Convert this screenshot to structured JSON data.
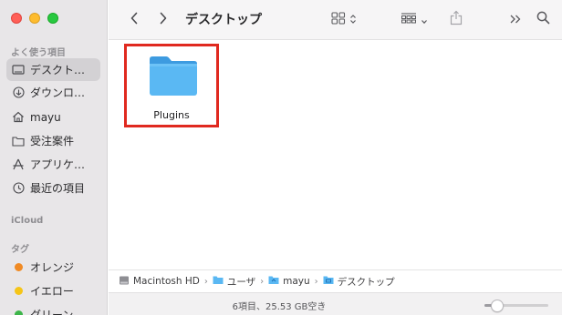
{
  "sidebar": {
    "favorites_title": "よく使う項目",
    "favorites": [
      {
        "label": "デスクトップ",
        "display": "デスクト…",
        "icon": "desktop-icon",
        "selected": true
      },
      {
        "label": "ダウンロード",
        "display": "ダウンロ…",
        "icon": "download-icon",
        "selected": false
      },
      {
        "label": "mayu",
        "display": "mayu",
        "icon": "home-icon",
        "selected": false
      },
      {
        "label": "受注案件",
        "display": "受注案件",
        "icon": "folder-icon",
        "selected": false
      },
      {
        "label": "アプリケーション",
        "display": "アプリケ…",
        "icon": "applications-icon",
        "selected": false
      },
      {
        "label": "最近の項目",
        "display": "最近の項目",
        "icon": "recents-icon",
        "selected": false
      }
    ],
    "icloud_title": "iCloud",
    "tags_title": "タグ",
    "tags": [
      {
        "label": "オレンジ",
        "color": "#f08a24"
      },
      {
        "label": "イエロー",
        "color": "#f5c518"
      },
      {
        "label": "グリーン",
        "color": "#3db54a"
      }
    ]
  },
  "toolbar": {
    "title": "デスクトップ",
    "back_icon": "chevron-left-icon",
    "forward_icon": "chevron-right-icon",
    "view_icon": "icon-grid-view-icon",
    "group_icon": "group-by-icon",
    "share_icon": "share-icon",
    "more_icon": "chevron-double-right-icon",
    "search_icon": "search-icon"
  },
  "content": {
    "items": [
      {
        "name": "Plugins",
        "icon": "folder-icon",
        "highlighted": true,
        "highlight_color": "#e0291f"
      }
    ]
  },
  "pathbar": {
    "crumbs": [
      {
        "label": "Macintosh HD",
        "icon": "hard-drive-icon"
      },
      {
        "label": "ユーザ",
        "icon": "folder-icon"
      },
      {
        "label": "mayu",
        "icon": "home-folder-icon"
      },
      {
        "label": "デスクトップ",
        "icon": "desktop-folder-icon"
      }
    ]
  },
  "statusbar": {
    "text": "6項目、25.53 GB空き",
    "zoom_level": 0.2
  },
  "colors": {
    "accent_folder": "#5ab4f0",
    "highlight": "#e0291f",
    "sidebar_bg": "#e8e6e8"
  }
}
